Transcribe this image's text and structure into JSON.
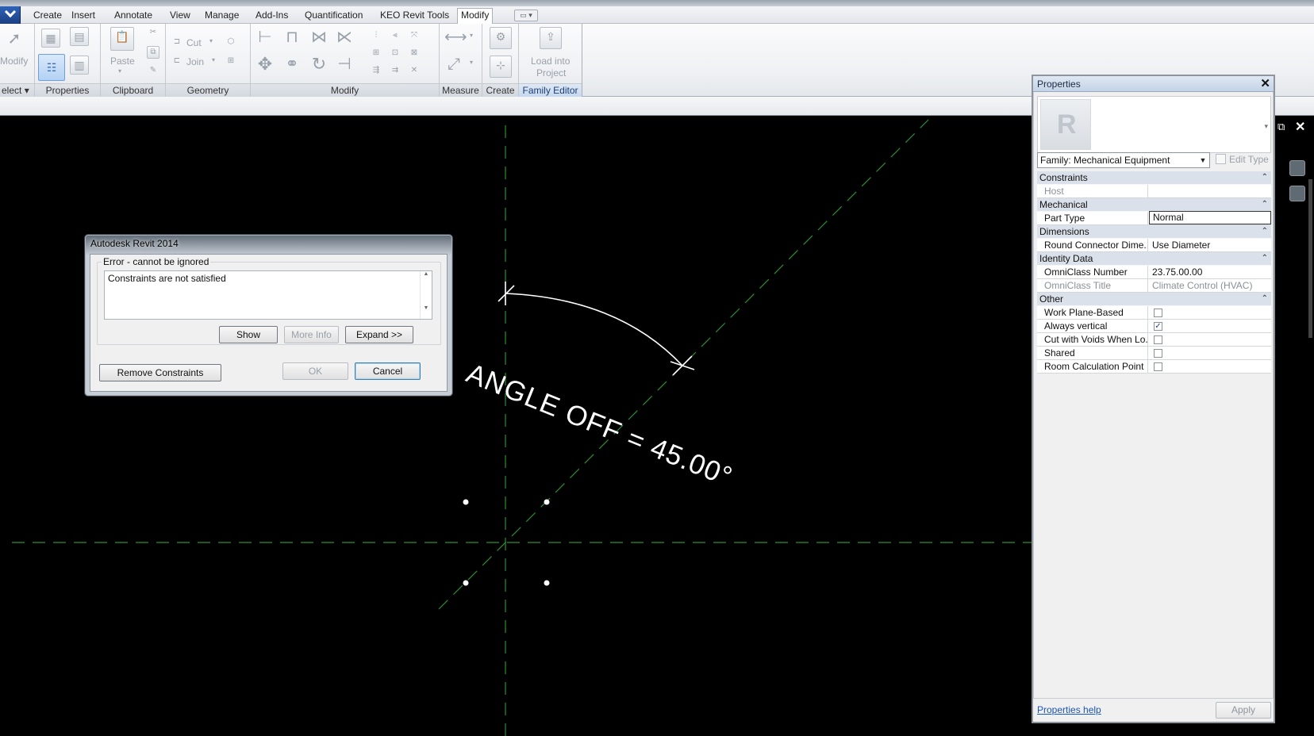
{
  "menu": {
    "tabs": [
      "Create",
      "Insert",
      "Annotate",
      "View",
      "Manage",
      "Add-Ins",
      "Quantification",
      "KEO Revit Tools",
      "Modify"
    ],
    "active_tab": "Modify"
  },
  "ribbon": {
    "select_label": "elect",
    "modify_label": "Modify",
    "paste_label": "Paste",
    "cut_label": "Cut",
    "join_label": "Join",
    "load_label_1": "Load into",
    "load_label_2": "Project",
    "panels": {
      "properties": "Properties",
      "clipboard": "Clipboard",
      "geometry": "Geometry",
      "modify": "Modify",
      "measure": "Measure",
      "create": "Create",
      "family_editor": "Family Editor"
    }
  },
  "canvas": {
    "dimension_text": "ANGLE OFF = 45.00°",
    "angle_degrees": 45.0
  },
  "dialog": {
    "title": "Autodesk Revit 2014",
    "group_label": "Error - cannot be ignored",
    "message": "Constraints are not satisfied",
    "show_btn": "Show",
    "more_info_btn": "More Info",
    "expand_btn": "Expand >>",
    "remove_btn": "Remove Constraints",
    "ok_btn": "OK",
    "cancel_btn": "Cancel"
  },
  "properties": {
    "title": "Properties",
    "family_select": "Family: Mechanical Equipment",
    "edit_type": "Edit Type",
    "help_link": "Properties help",
    "apply_btn": "Apply",
    "groups": {
      "constraints": "Constraints",
      "mechanical": "Mechanical",
      "dimensions": "Dimensions",
      "identity": "Identity Data",
      "other": "Other"
    },
    "rows": {
      "host": {
        "name": "Host",
        "value": ""
      },
      "part_type": {
        "name": "Part Type",
        "value": "Normal"
      },
      "round_connector": {
        "name": "Round Connector Dime...",
        "value": "Use Diameter"
      },
      "omniclass_number": {
        "name": "OmniClass Number",
        "value": "23.75.00.00"
      },
      "omniclass_title": {
        "name": "OmniClass Title",
        "value": "Climate Control (HVAC)"
      },
      "work_plane_based": {
        "name": "Work Plane-Based",
        "checked": false
      },
      "always_vertical": {
        "name": "Always vertical",
        "checked": true
      },
      "cut_with_voids": {
        "name": "Cut with Voids When Lo...",
        "checked": false
      },
      "shared": {
        "name": "Shared",
        "checked": false
      },
      "room_calc_point": {
        "name": "Room Calculation Point",
        "checked": false
      }
    }
  },
  "colors": {
    "canvas_bg": "#000000",
    "reference_plane": "#2f8f2f",
    "dimension": "#ffffff"
  },
  "icons": [
    "select-arrow-icon",
    "paste-icon",
    "cut-icon",
    "join-icon",
    "move-icon",
    "rotate-icon",
    "measure-icon",
    "load-into-project-icon",
    "close-icon",
    "dropdown-icon",
    "checkbox-icon",
    "collapse-icon"
  ]
}
